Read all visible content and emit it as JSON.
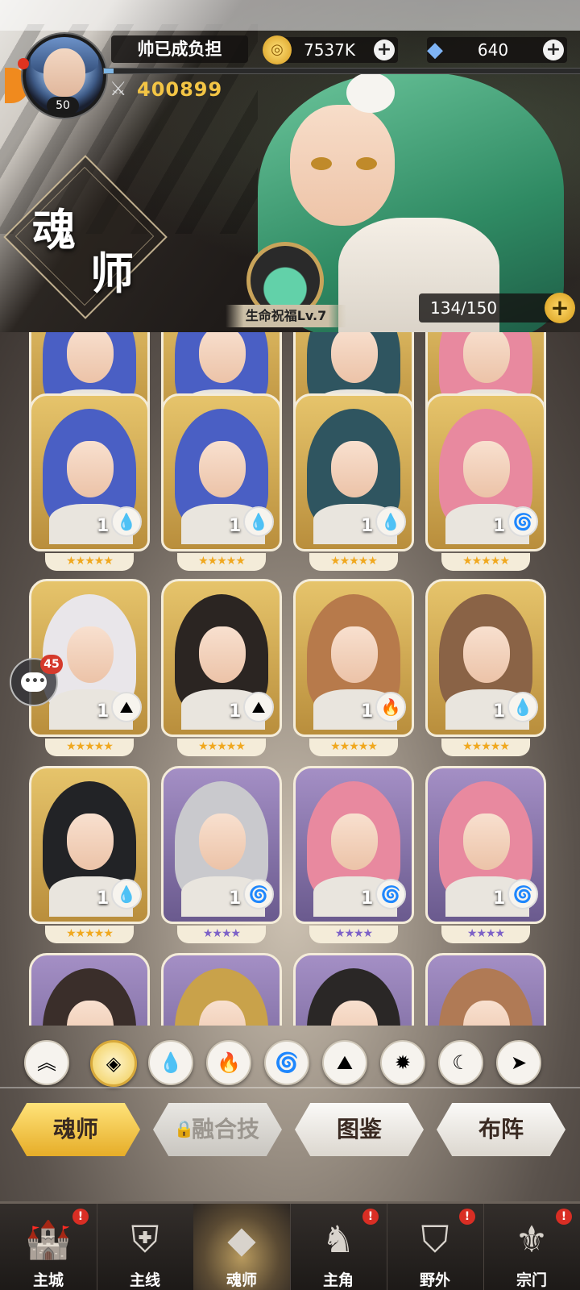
{
  "player": {
    "name": "帅已成负担",
    "level": "50",
    "power": "400899",
    "exp_fraction": 0.02
  },
  "currencies": {
    "gold": {
      "value": "7537K",
      "icon": "gold-coin-icon"
    },
    "diamond": {
      "value": "640",
      "icon": "diamond-icon"
    }
  },
  "page": {
    "title_line1": "魂",
    "title_line2": "师"
  },
  "blessing": {
    "label": "生命祝福Lv.7"
  },
  "capacity": {
    "value": "134/150"
  },
  "chat": {
    "badge": "45"
  },
  "cards": [
    {
      "level": "1",
      "element": "water",
      "stars": "★★★★★",
      "rarity": "gold",
      "hair": "#4a5fc4"
    },
    {
      "level": "1",
      "element": "water",
      "stars": "★★★★★",
      "rarity": "gold",
      "hair": "#4a5fc4"
    },
    {
      "level": "1",
      "element": "water",
      "stars": "★★★★★",
      "rarity": "gold",
      "hair": "#2f5560"
    },
    {
      "level": "1",
      "element": "wind",
      "stars": "★★★★★",
      "rarity": "gold",
      "hair": "#e8899f"
    },
    {
      "level": "1",
      "element": "earth",
      "stars": "★★★★★",
      "rarity": "gold",
      "hair": "#e9e6ea"
    },
    {
      "level": "1",
      "element": "earth",
      "stars": "★★★★★",
      "rarity": "gold",
      "hair": "#2b2522"
    },
    {
      "level": "1",
      "element": "fire",
      "stars": "★★★★★",
      "rarity": "gold",
      "hair": "#b77a4b"
    },
    {
      "level": "1",
      "element": "water",
      "stars": "★★★★★",
      "rarity": "gold",
      "hair": "#8a6346"
    },
    {
      "level": "1",
      "element": "water",
      "stars": "★★★★★",
      "rarity": "gold",
      "hair": "#222326"
    },
    {
      "level": "1",
      "element": "wind",
      "stars": "★★★★",
      "rarity": "purple",
      "hair": "#c9c9cd"
    },
    {
      "level": "1",
      "element": "wind",
      "stars": "★★★★",
      "rarity": "purple",
      "hair": "#e8899f"
    },
    {
      "level": "1",
      "element": "wind",
      "stars": "★★★★",
      "rarity": "purple",
      "hair": "#e8899f"
    }
  ],
  "element_glyphs": {
    "water": "💧",
    "wind": "🌀",
    "earth": "⛰",
    "fire": "🔥"
  },
  "filters": [
    {
      "name": "filter-up-arrows-icon",
      "glyph": "︽"
    },
    {
      "name": "filter-all-icon",
      "glyph": "◈",
      "active": true
    },
    {
      "name": "filter-water-icon",
      "glyph": "💧"
    },
    {
      "name": "filter-fire-icon",
      "glyph": "🔥"
    },
    {
      "name": "filter-wind-icon",
      "glyph": "🌀"
    },
    {
      "name": "filter-earth-icon",
      "glyph": "⛰"
    },
    {
      "name": "filter-light-icon",
      "glyph": "✹"
    },
    {
      "name": "filter-dark-icon",
      "glyph": "☾"
    },
    {
      "name": "filter-special-icon",
      "glyph": "➤"
    }
  ],
  "tabs": {
    "soul_master": "魂师",
    "fusion_skill": "融合技",
    "gallery": "图鉴",
    "formation": "布阵"
  },
  "nav": [
    {
      "label": "主城",
      "icon": "castle-icon",
      "glyph": "🏰",
      "badge": "!"
    },
    {
      "label": "主线",
      "icon": "mainline-icon",
      "glyph": "⛨",
      "badge": ""
    },
    {
      "label": "魂师",
      "icon": "soul-master-icon",
      "glyph": "◆",
      "badge": "",
      "active": true
    },
    {
      "label": "主角",
      "icon": "hero-icon",
      "glyph": "♞",
      "badge": "!"
    },
    {
      "label": "野外",
      "icon": "wild-icon",
      "glyph": "⛉",
      "badge": "!"
    },
    {
      "label": "宗门",
      "icon": "sect-icon",
      "glyph": "⚜",
      "badge": "!"
    }
  ],
  "colors": {
    "accent_gold": "#f3c545",
    "active_tab": "#e6ad28",
    "badge_red": "#d92e24"
  }
}
